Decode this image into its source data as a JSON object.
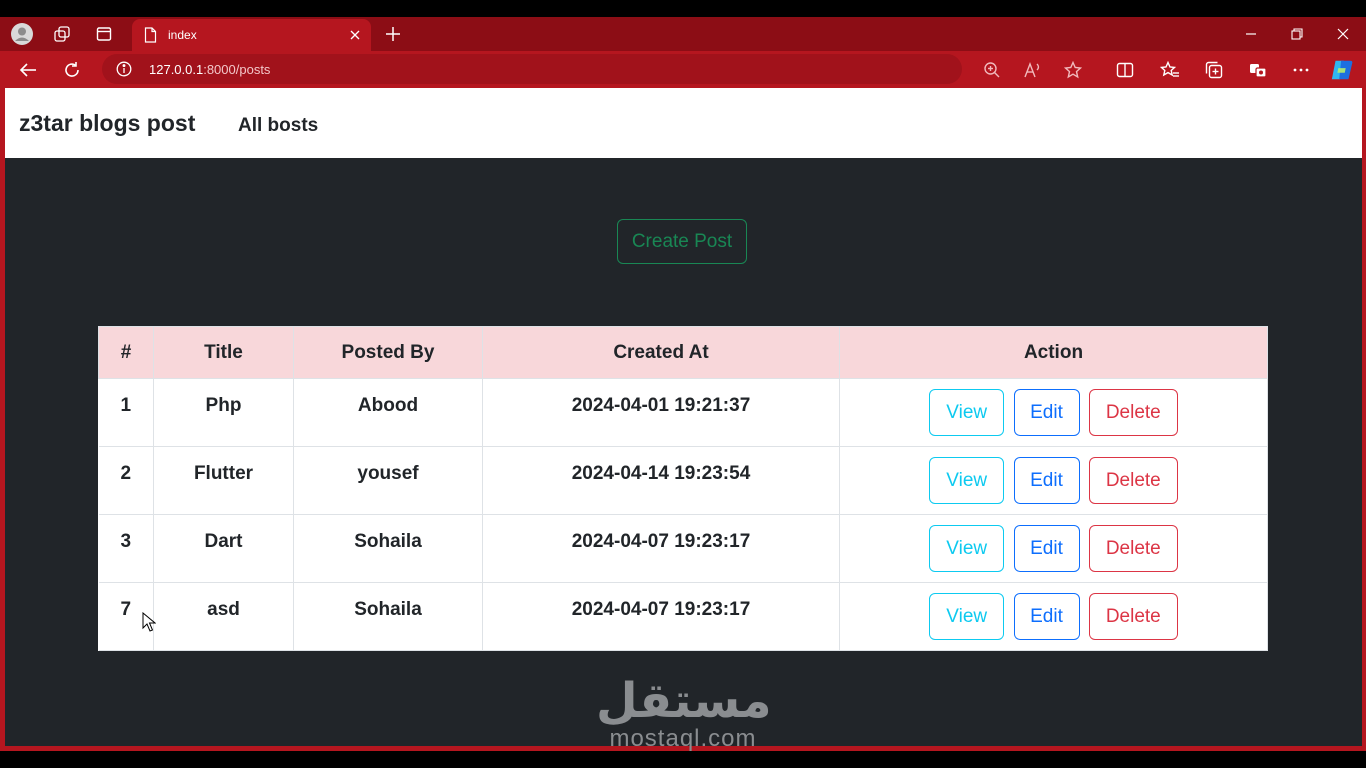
{
  "browser": {
    "tab_title": "index",
    "address_host": "127.0.0.1",
    "address_path": ":8000/posts",
    "colors": {
      "frame": "#b5161f",
      "tabstrip": "#8c0d15"
    }
  },
  "site": {
    "brand": "z3tar blogs post",
    "nav_link": "All bosts",
    "create_button": "Create Post"
  },
  "table": {
    "headers": [
      "#",
      "Title",
      "Posted By",
      "Created At",
      "Action"
    ],
    "rows": [
      {
        "id": "1",
        "title": "Php",
        "posted_by": "Abood",
        "created_at": "2024-04-01 19:21:37"
      },
      {
        "id": "2",
        "title": "Flutter",
        "posted_by": "yousef",
        "created_at": "2024-04-14 19:23:54"
      },
      {
        "id": "3",
        "title": "Dart",
        "posted_by": "Sohaila",
        "created_at": "2024-04-07 19:23:17"
      },
      {
        "id": "7",
        "title": "asd",
        "posted_by": "Sohaila",
        "created_at": "2024-04-07 19:23:17"
      }
    ],
    "actions": {
      "view": "View",
      "edit": "Edit",
      "delete": "Delete"
    }
  },
  "watermark": {
    "arabic": "مستقل",
    "latin": "mostaql.com"
  }
}
